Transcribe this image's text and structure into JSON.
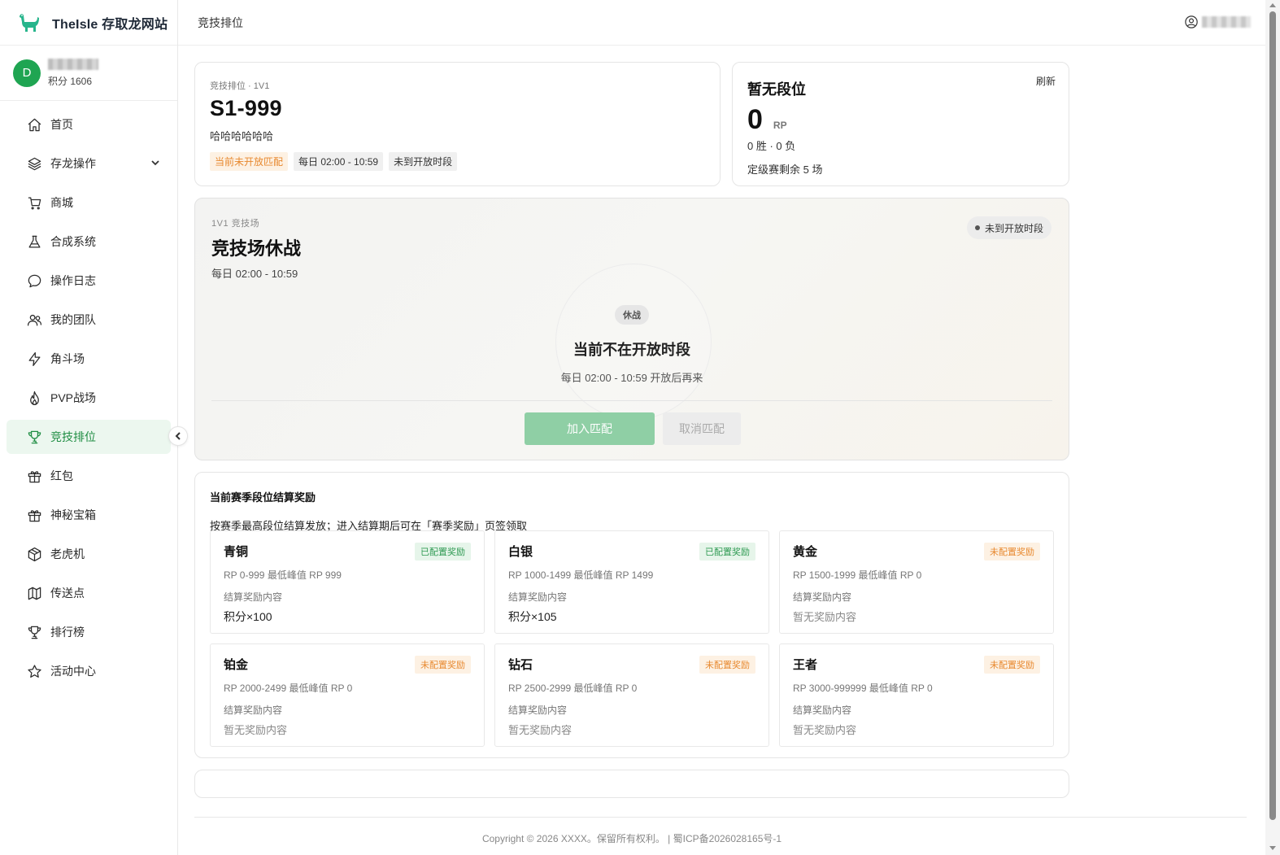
{
  "brand": {
    "title": "TheIsle 存取龙网站"
  },
  "user": {
    "avatar_letter": "D",
    "points": "积分 1606"
  },
  "sidebar": {
    "items": [
      {
        "label": "首页",
        "icon": "home-icon"
      },
      {
        "label": "存龙操作",
        "icon": "layers-icon"
      },
      {
        "label": "商城",
        "icon": "cart-icon"
      },
      {
        "label": "合成系统",
        "icon": "flask-icon"
      },
      {
        "label": "操作日志",
        "icon": "message-icon"
      },
      {
        "label": "我的团队",
        "icon": "team-icon"
      },
      {
        "label": "角斗场",
        "icon": "bolt-icon"
      },
      {
        "label": "PVP战场",
        "icon": "flame-icon"
      },
      {
        "label": "竞技排位",
        "icon": "trophy-icon"
      },
      {
        "label": "红包",
        "icon": "gift-icon"
      },
      {
        "label": "神秘宝箱",
        "icon": "gift-box-icon"
      },
      {
        "label": "老虎机",
        "icon": "cube-icon"
      },
      {
        "label": "传送点",
        "icon": "map-icon"
      },
      {
        "label": "排行榜",
        "icon": "trophy-icon"
      },
      {
        "label": "活动中心",
        "icon": "star-icon"
      }
    ],
    "active": "竞技排位"
  },
  "topbar": {
    "title": "竞技排位"
  },
  "season": {
    "sub": "竞技排位 · 1V1",
    "name": "S1-999",
    "desc": "哈哈哈哈哈哈",
    "tags": [
      "当前未开放匹配",
      "每日 02:00 - 10:59",
      "未到开放时段"
    ]
  },
  "rank": {
    "title": "暂无段位",
    "refresh": "刷新",
    "rp": "0",
    "rp_unit": "RP",
    "record": "0 胜 · 0 负",
    "remain": "定级赛剩余 5 场"
  },
  "arena": {
    "sub": "1V1 竞技场",
    "title": "竞技场休战",
    "time": "每日 02:00 - 10:59",
    "status": "未到开放时段",
    "badge": "休战",
    "message": "当前不在开放时段",
    "message_sub": "每日 02:00 - 10:59 开放后再来",
    "join_label": "加入匹配",
    "cancel_label": "取消匹配"
  },
  "rewards": {
    "title": "当前赛季段位结算奖励",
    "desc": "按赛季最高段位结算发放；进入结算期后可在「赛季奖励」页签领取",
    "content_label": "结算奖励内容",
    "tiers": [
      {
        "name": "青铜",
        "status": "已配置奖励",
        "range": "RP 0-999  最低峰值 RP 999",
        "content": "积分×100"
      },
      {
        "name": "白银",
        "status": "已配置奖励",
        "range": "RP 1000-1499  最低峰值 RP 1499",
        "content": "积分×105"
      },
      {
        "name": "黄金",
        "status": "未配置奖励",
        "range": "RP 1500-1999  最低峰值 RP 0",
        "content": "暂无奖励内容"
      },
      {
        "name": "铂金",
        "status": "未配置奖励",
        "range": "RP 2000-2499  最低峰值 RP 0",
        "content": "暂无奖励内容"
      },
      {
        "name": "钻石",
        "status": "未配置奖励",
        "range": "RP 2500-2999  最低峰值 RP 0",
        "content": "暂无奖励内容"
      },
      {
        "name": "王者",
        "status": "未配置奖励",
        "range": "RP 3000-999999  最低峰值 RP 0",
        "content": "暂无奖励内容"
      }
    ]
  },
  "footer": {
    "text": "Copyright © 2026 XXXX。保留所有权利。 | 蜀ICP备2026028165号-1"
  },
  "colors": {
    "brand_green": "#1f8d43",
    "avatar_green": "#1fa552",
    "orange": "#e8892f"
  }
}
